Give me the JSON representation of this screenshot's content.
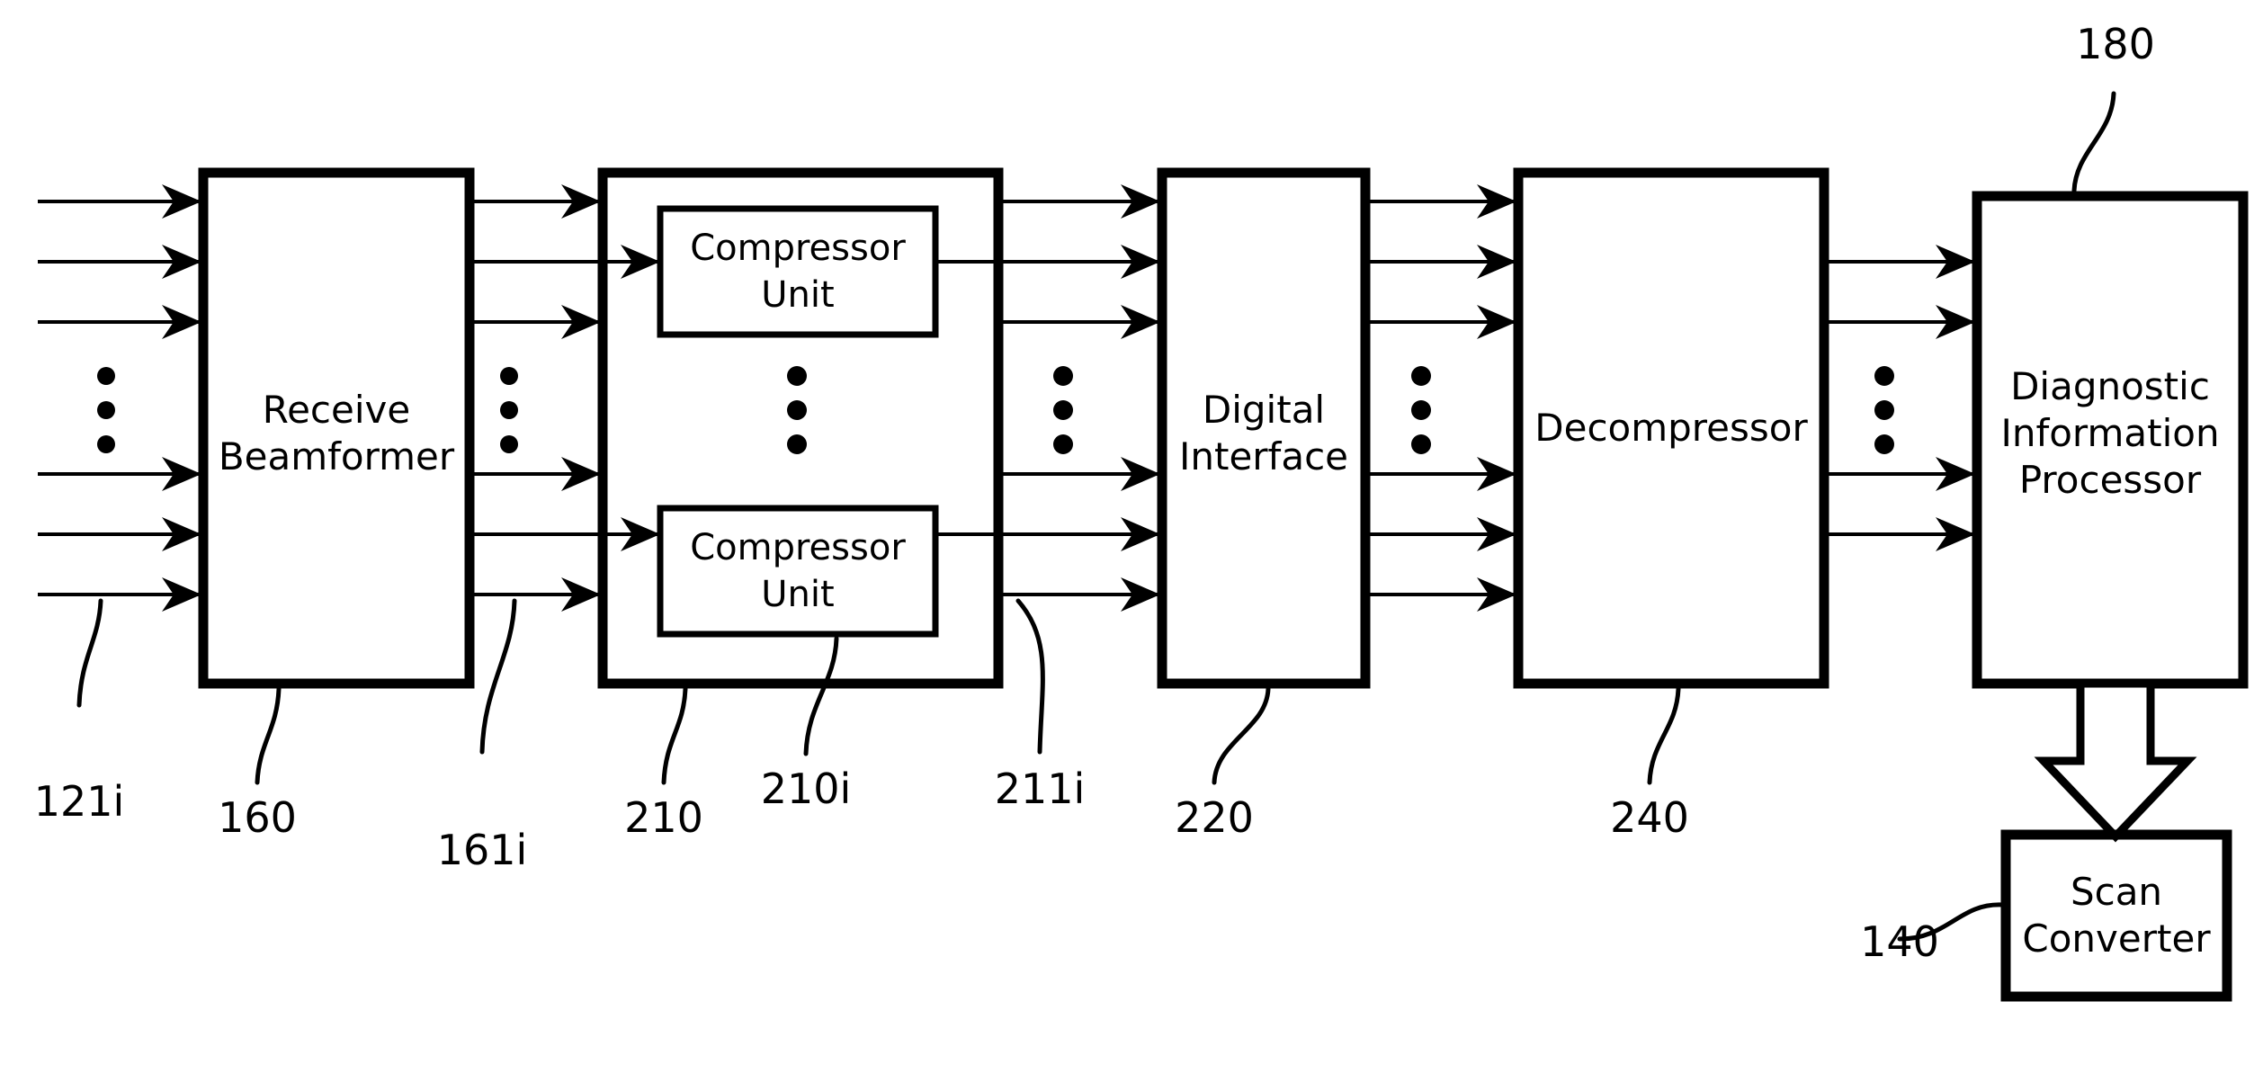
{
  "figure": {
    "type": "patent-block-diagram",
    "background_color": "#ffffff",
    "line_color": "#000000",
    "blocks": [
      {
        "id": "receive_beamformer",
        "label_lines": [
          "Receive",
          "Beamformer"
        ],
        "ref": "160",
        "border": "thick"
      },
      {
        "id": "compressor_group",
        "label_lines": [],
        "ref": "210",
        "border": "thick"
      },
      {
        "id": "compressor_unit_top",
        "label_lines": [
          "Compressor",
          "Unit"
        ],
        "ref": "210i",
        "border": "medium"
      },
      {
        "id": "compressor_unit_bottom",
        "label_lines": [
          "Compressor",
          "Unit"
        ],
        "ref": "210i",
        "border": "medium"
      },
      {
        "id": "digital_interface",
        "label_lines": [
          "Digital",
          "Interface"
        ],
        "ref": "220",
        "border": "thick"
      },
      {
        "id": "decompressor",
        "label_lines": [
          "Decompressor"
        ],
        "ref": "240",
        "border": "thick"
      },
      {
        "id": "diagnostic_information_processor",
        "label_lines": [
          "Diagnostic",
          "Information",
          "Processor"
        ],
        "ref": "180",
        "border": "thick"
      },
      {
        "id": "scan_converter",
        "label_lines": [
          "Scan",
          "Converter"
        ],
        "ref": "140",
        "border": "thick"
      }
    ],
    "labels": {
      "receive_beamformer_l1": "Receive",
      "receive_beamformer_l2": "Beamformer",
      "compressor_top_l1": "Compressor",
      "compressor_top_l2": "Unit",
      "compressor_bottom_l1": "Compressor",
      "compressor_bottom_l2": "Unit",
      "digital_interface_l1": "Digital",
      "digital_interface_l2": "Interface",
      "decompressor_l1": "Decompressor",
      "diagnostic_l1": "Diagnostic",
      "diagnostic_l2": "Information",
      "diagnostic_l3": "Processor",
      "scan_converter_l1": "Scan",
      "scan_converter_l2": "Converter"
    },
    "reference_numerals": {
      "inputs_121i": "121i",
      "receive_beamformer_160": "160",
      "beamformer_outputs_161i": "161i",
      "compressor_group_210": "210",
      "compressor_unit_210i": "210i",
      "compressor_outputs_211i": "211i",
      "digital_interface_220": "220",
      "decompressor_240": "240",
      "diagnostic_processor_180": "180",
      "scan_converter_140": "140"
    },
    "signal_rows": {
      "upper": [
        224,
        291,
        358
      ],
      "lower": [
        527,
        594,
        661
      ],
      "ellipsis_center": 456
    },
    "connections": [
      {
        "from": "external",
        "to": "receive_beamformer",
        "count": 6,
        "ref": "121i"
      },
      {
        "from": "receive_beamformer",
        "to": "compressor_group",
        "count": 6,
        "ref": "161i"
      },
      {
        "from": "compressor_group",
        "to": "digital_interface",
        "count": 6,
        "ref": "211i"
      },
      {
        "from": "digital_interface",
        "to": "decompressor",
        "count": 6
      },
      {
        "from": "decompressor",
        "to": "diagnostic_information_processor",
        "count": 4
      },
      {
        "from": "diagnostic_information_processor",
        "to": "scan_converter",
        "count": 1,
        "style": "hollow-block-arrow"
      }
    ]
  }
}
